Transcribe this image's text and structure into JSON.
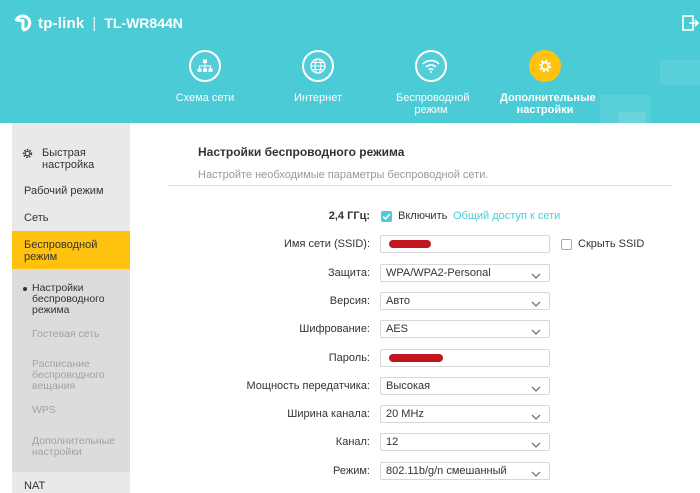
{
  "header": {
    "brand": "tp-link",
    "separator": "|",
    "model": "TL-WR844N",
    "nav": [
      {
        "label": "Схема сети",
        "icon": "network-map-icon"
      },
      {
        "label": "Интернет",
        "icon": "globe-icon"
      },
      {
        "label": "Беспроводной режим",
        "icon": "wifi-icon"
      },
      {
        "label": "Дополнительные настройки",
        "icon": "gear-icon",
        "active": true
      }
    ],
    "colors": {
      "accent": "#4acbd6",
      "active": "#ffc20e"
    }
  },
  "sidebar": {
    "items": [
      {
        "label": "Быстрая настройка",
        "icon": "gear-icon"
      },
      {
        "label": "Рабочий режим"
      },
      {
        "label": "Сеть"
      },
      {
        "label": "Беспроводной режим",
        "active": true
      },
      {
        "label": "NAT"
      }
    ],
    "subitems": [
      {
        "label": "Настройки беспроводного режима",
        "current": true
      },
      {
        "label": "Гостевая сеть"
      },
      {
        "label": "Расписание беспроводного вещания"
      },
      {
        "label": "WPS"
      },
      {
        "label": "Дополнительные настройки"
      }
    ]
  },
  "main": {
    "title": "Настройки беспроводного режима",
    "subtitle": "Настройте необходимые параметры беспроводной сети.",
    "band": {
      "label": "2,4 ГГц:",
      "enable_label": "Включить",
      "enabled": true,
      "share_link": "Общий доступ к сети"
    },
    "ssid": {
      "label": "Имя сети (SSID):",
      "hide_label": "Скрыть SSID",
      "hidden": false
    },
    "security": {
      "label": "Защита:",
      "value": "WPA/WPA2-Personal"
    },
    "version": {
      "label": "Версия:",
      "value": "Авто"
    },
    "encryption": {
      "label": "Шифрование:",
      "value": "AES"
    },
    "password": {
      "label": "Пароль:"
    },
    "tx_power": {
      "label": "Мощность передатчика:",
      "value": "Высокая"
    },
    "channel_width": {
      "label": "Ширина канала:",
      "value": "20 MHz"
    },
    "channel": {
      "label": "Канал:",
      "value": "12"
    },
    "mode": {
      "label": "Режим:",
      "value": "802.11b/g/n смешанный"
    }
  }
}
